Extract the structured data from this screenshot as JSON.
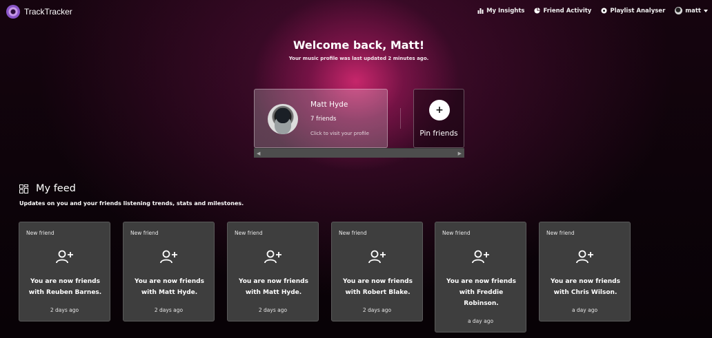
{
  "app": {
    "name": "TrackTracker"
  },
  "nav": {
    "items": [
      {
        "label": "My Insights",
        "icon": "bar-chart-icon"
      },
      {
        "label": "Friend Activity",
        "icon": "pie-chart-icon"
      },
      {
        "label": "Playlist Analyser",
        "icon": "record-icon"
      }
    ],
    "user": {
      "label": "matt",
      "icon": "user-avatar-icon"
    }
  },
  "hero": {
    "title": "Welcome back, Matt!",
    "subtitle": "Your music profile was last updated 2 minutes ago."
  },
  "profile": {
    "name": "Matt Hyde",
    "friends": "7 friends",
    "cta": "Click to visit your profile"
  },
  "pin": {
    "icon_text": "+",
    "label": "Pin friends"
  },
  "feed": {
    "title": "My feed",
    "subtitle": "Updates on you and your friends listening trends, stats and milestones.",
    "cards": [
      {
        "type": "New friend",
        "text": "You are now friends with Reuben Barnes.",
        "time": "2 days ago"
      },
      {
        "type": "New friend",
        "text": "You are now friends with Matt Hyde.",
        "time": "2 days ago"
      },
      {
        "type": "New friend",
        "text": "You are now friends with Matt Hyde.",
        "time": "2 days ago"
      },
      {
        "type": "New friend",
        "text": "You are now friends with Robert Blake.",
        "time": "2 days ago"
      },
      {
        "type": "New friend",
        "text": "You are now friends with Freddie Robinson.",
        "time": "a day ago"
      },
      {
        "type": "New friend",
        "text": "You are now friends with Chris Wilson.",
        "time": "a day ago"
      }
    ]
  },
  "colors": {
    "accent": "#c0286e",
    "card": "#3e3e3e",
    "background": "#0a0308"
  }
}
